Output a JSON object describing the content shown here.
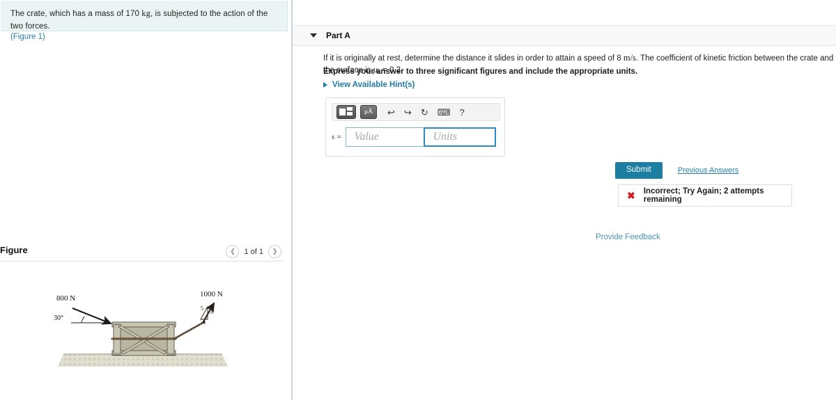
{
  "left": {
    "problem": {
      "text_before": "The crate, which has a mass of 170 ",
      "mass_unit": "kg",
      "text_after": ", is subjected to the action of the two forces.",
      "figure_link": "(Figure 1)"
    },
    "figure": {
      "title": "Figure",
      "prev_icon": "chevron-left-icon",
      "next_icon": "chevron-right-icon",
      "page_count": "1 of 1",
      "labels": {
        "force_left": "800 N",
        "angle_left": "30°",
        "force_right": "1000 N",
        "tri_hyp": "5",
        "tri_vert": "3",
        "tri_horiz": "4"
      }
    }
  },
  "right": {
    "part": {
      "caret_icon": "caret-down-icon",
      "label": "Part A"
    },
    "question": {
      "main_a": "If it is originally at rest, determine the distance it slides in order to attain a speed of 8 ",
      "main_unit": "m/s",
      "main_b": ". The coefficient of kinetic friction between the crate and the surface is ",
      "mu_symbol": "μ",
      "mu_sub": "k",
      "mu_value": " = 0.2.",
      "express": "Express your answer to three significant figures and include the appropriate units.",
      "hints_label": "View Available Hint(s)",
      "hints_caret_icon": "caret-right-icon"
    },
    "answer": {
      "toolbar": [
        {
          "name": "template-icon",
          "glyph": ""
        },
        {
          "name": "units-mu-angstrom-icon",
          "glyph": "μÅ"
        },
        {
          "name": "undo-icon",
          "glyph": "↩"
        },
        {
          "name": "redo-icon",
          "glyph": "↪"
        },
        {
          "name": "reset-icon",
          "glyph": "↻"
        },
        {
          "name": "keyboard-icon",
          "glyph": "⌨"
        },
        {
          "name": "help-icon",
          "glyph": "?"
        }
      ],
      "variable_label": "s =",
      "value_placeholder": "Value",
      "units_placeholder": "Units",
      "value_current": "",
      "units_current": ""
    },
    "actions": {
      "submit_label": "Submit",
      "previous_answers_label": "Previous Answers"
    },
    "feedback": {
      "icon": "x-mark-icon",
      "icon_glyph": "✖",
      "message": "Incorrect; Try Again; 2 attempts remaining"
    },
    "provide_feedback_label": "Provide Feedback"
  },
  "colors": {
    "accent": "#1c7ea3",
    "link": "#2a7fa8",
    "error": "#d01e22",
    "statement_bg": "#e9f4f3",
    "band_bg": "#f8f8f8"
  }
}
